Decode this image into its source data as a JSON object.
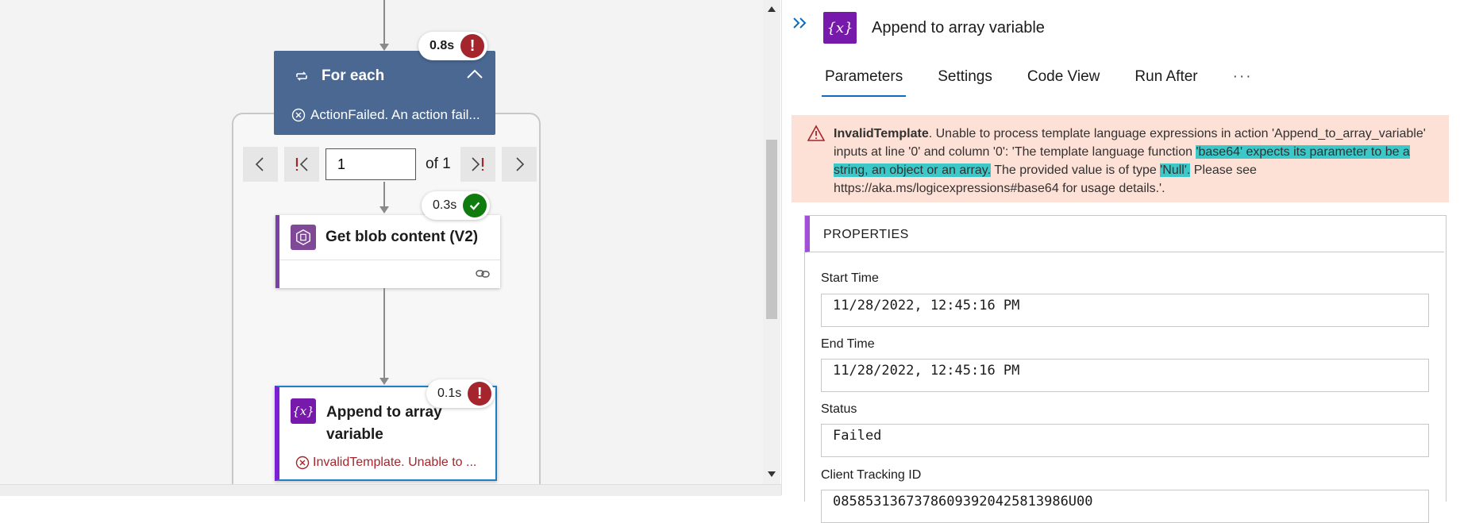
{
  "canvas": {
    "foreach": {
      "title": "For each",
      "duration": "0.8s",
      "status": "error",
      "error_text": "ActionFailed. An action fail..."
    },
    "pager": {
      "page": "1",
      "of_label": "of 1"
    },
    "get_blob": {
      "title": "Get blob content (V2)",
      "duration": "0.3s",
      "status": "success"
    },
    "append": {
      "title": "Append to array variable",
      "duration": "0.1s",
      "status": "error",
      "error_text": "InvalidTemplate. Unable to ..."
    }
  },
  "panel": {
    "title": "Append to array variable",
    "tabs": [
      {
        "label": "Parameters",
        "active": true
      },
      {
        "label": "Settings",
        "active": false
      },
      {
        "label": "Code View",
        "active": false
      },
      {
        "label": "Run After",
        "active": false
      }
    ],
    "more_label": "···",
    "error": {
      "code": "InvalidTemplate",
      "part1": ". Unable to process template language expressions in action 'Append_to_array_variable' inputs at line '0' and column '0': 'The template language function ",
      "highlight1": "'base64' expects its parameter to be a string, an object or an array.",
      "part2": " The provided value is of type ",
      "highlight2": "'Null'.",
      "part3": " Please see https://aka.ms/logicexpressions#base64 for usage details.'."
    },
    "properties": {
      "header": "PROPERTIES",
      "start_time_label": "Start Time",
      "start_time": "11/28/2022, 12:45:16 PM",
      "end_time_label": "End Time",
      "end_time": "11/28/2022, 12:45:16 PM",
      "status_label": "Status",
      "status": "Failed",
      "tracking_label": "Client Tracking ID",
      "tracking_value": "08585313673786093920425813986U00"
    }
  },
  "colors": {
    "foreach_header": "#4a6892",
    "error_red": "#a4262c",
    "success_green": "#107c10",
    "variable_purple": "#7719aa",
    "error_banner": "#fde0d6",
    "highlight": "#3cc8c8"
  }
}
